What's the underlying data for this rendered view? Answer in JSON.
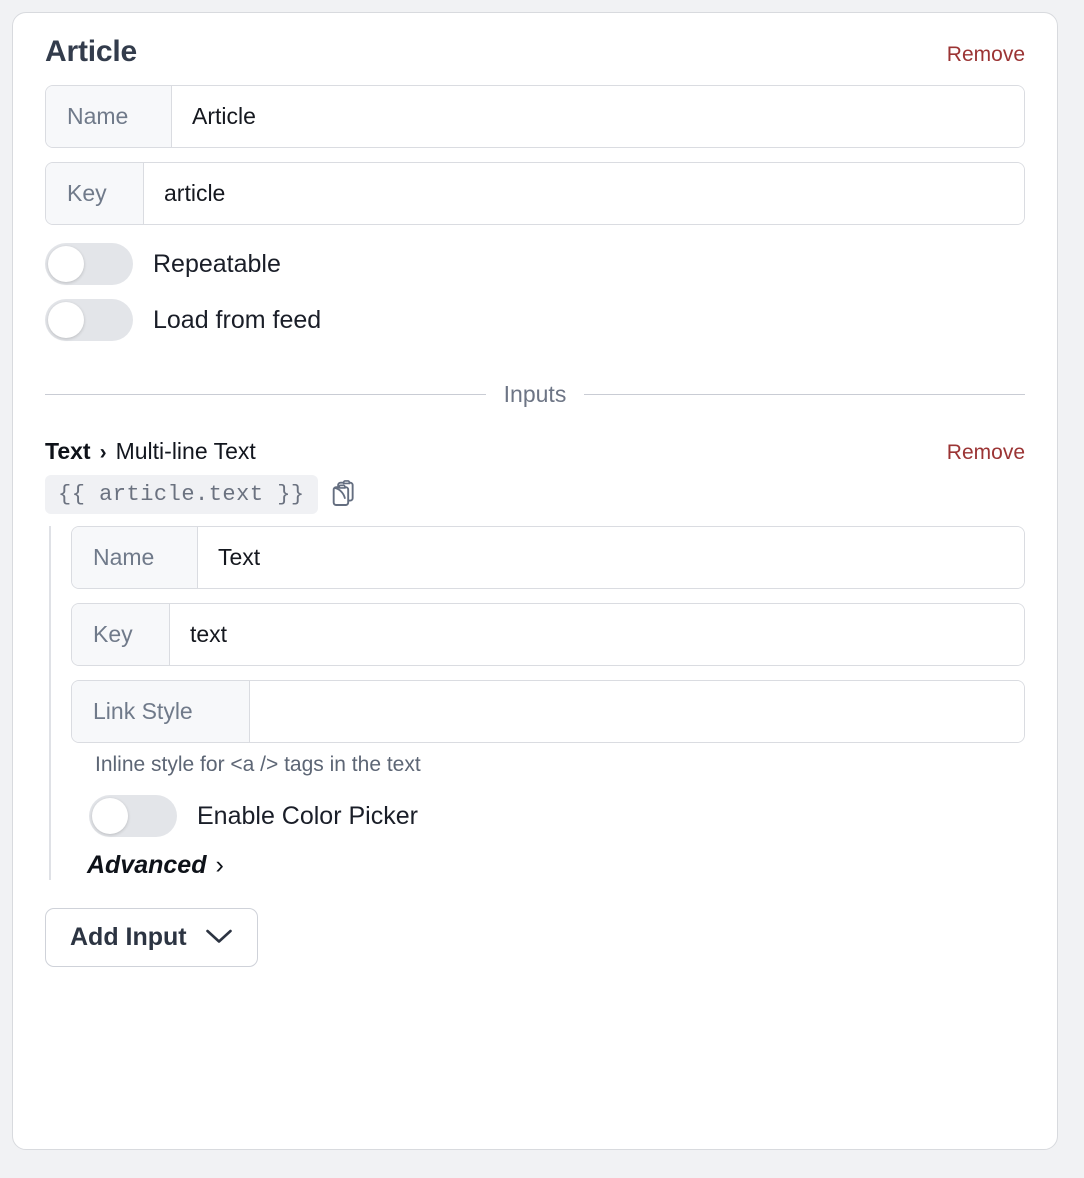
{
  "block": {
    "title": "Article",
    "remove_label": "Remove",
    "fields": [
      {
        "label": "Name",
        "value": "Article",
        "placeholder": ""
      },
      {
        "label": "Key",
        "value": "article",
        "placeholder": ""
      }
    ],
    "toggles": [
      {
        "label": "Repeatable",
        "on": false
      },
      {
        "label": "Load from feed",
        "on": false
      }
    ]
  },
  "divider": {
    "caption": "Inputs"
  },
  "input": {
    "type_name": "Text",
    "separator": "›",
    "type_kind": "Multi-line Text",
    "remove_label": "Remove",
    "binding_expression": "{{ article.text }}",
    "copy_icon": "copy-icon",
    "fields": [
      {
        "label": "Name",
        "value": "Text",
        "placeholder": ""
      },
      {
        "label": "Key",
        "value": "text",
        "placeholder": ""
      },
      {
        "label": "Link Style",
        "value": "",
        "placeholder": ""
      }
    ],
    "hint": "Inline style for <a /> tags in the text",
    "toggle": {
      "label": "Enable Color Picker",
      "on": false
    },
    "advanced_label": "Advanced",
    "advanced_chevron": "›"
  },
  "footer": {
    "add_input_label": "Add Input",
    "add_input_chevron": "chevron-down-icon"
  },
  "colors": {
    "page_background": "#f1f2f4",
    "card_background": "#ffffff",
    "card_border": "#d8dade",
    "title_text": "#333c4c",
    "remove_link": "#9b3434",
    "field_label_background": "#f7f8fa",
    "field_border": "#dadce1",
    "toggle_track_off": "#e3e5e9",
    "toggle_knob": "#ffffff",
    "chip_background": "#f0f1f4",
    "chip_text": "#6b7280",
    "hint_text": "#5d6675",
    "divider_rule": "#c9ccd4"
  }
}
